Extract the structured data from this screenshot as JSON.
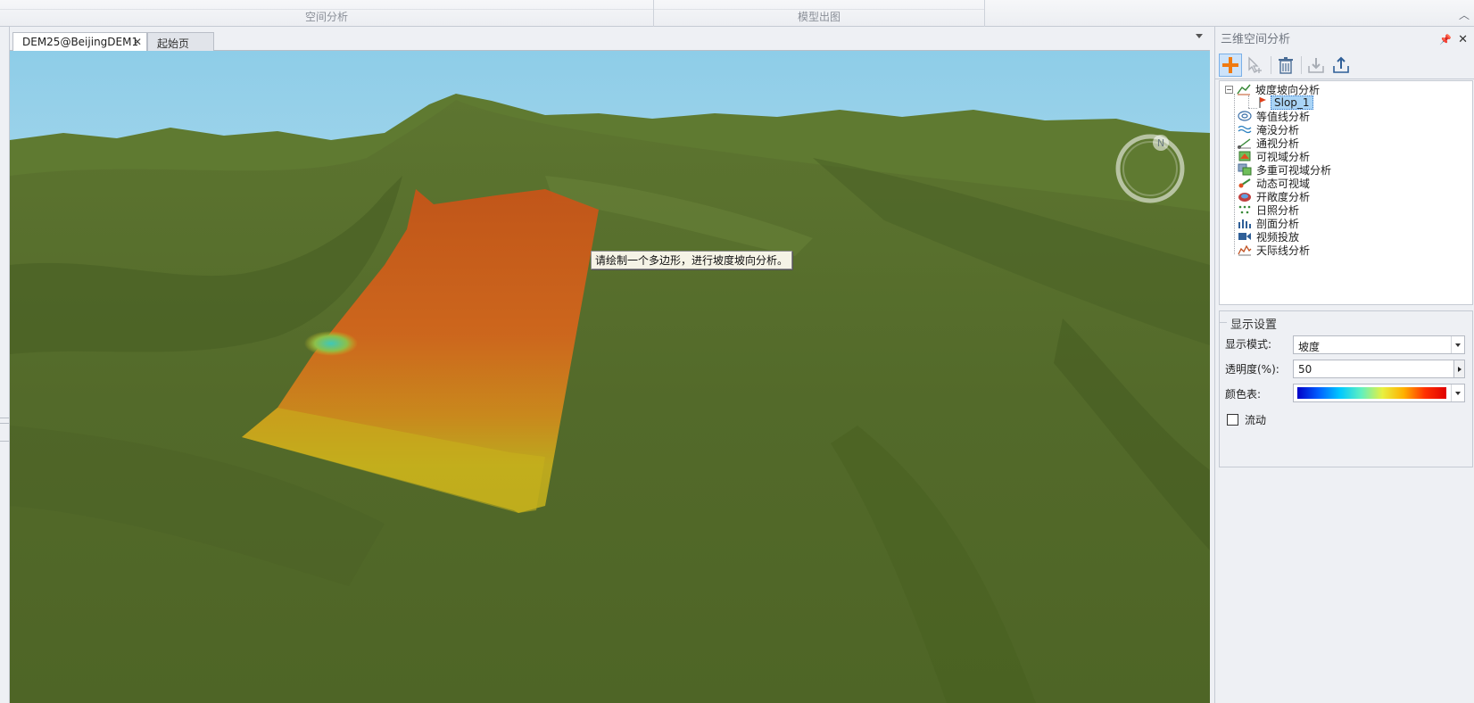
{
  "ribbon": {
    "groups": [
      {
        "label": "空间分析"
      },
      {
        "label": "模型出图"
      }
    ]
  },
  "doc_tabs": [
    {
      "label": "DEM25@BeijingDEM1",
      "active": true
    },
    {
      "label": "起始页",
      "active": false
    }
  ],
  "scene": {
    "tooltip": "请绘制一个多边形，进行坡度坡向分析。",
    "compass_letter": "N"
  },
  "panel": {
    "title": "三维空间分析",
    "toolbar": [
      {
        "icon": "add-icon",
        "enabled": true
      },
      {
        "icon": "select-cursor-icon",
        "enabled": false
      },
      {
        "icon": "delete-icon",
        "enabled": true
      },
      {
        "icon": "import-icon",
        "enabled": false
      },
      {
        "icon": "export-icon",
        "enabled": true
      }
    ],
    "tree": [
      {
        "label": "坡度坡向分析",
        "icon": "slope-icon",
        "expanded": true,
        "children": [
          {
            "label": "Slop_1",
            "icon": "flag-icon",
            "selected": true
          }
        ]
      },
      {
        "label": "等值线分析",
        "icon": "contour-icon"
      },
      {
        "label": "淹没分析",
        "icon": "flood-icon"
      },
      {
        "label": "通视分析",
        "icon": "sightline-icon"
      },
      {
        "label": "可视域分析",
        "icon": "viewshed-icon"
      },
      {
        "label": "多重可视域分析",
        "icon": "multi-viewshed-icon"
      },
      {
        "label": "动态可视域",
        "icon": "dynamic-viewshed-icon"
      },
      {
        "label": "开敞度分析",
        "icon": "openness-icon"
      },
      {
        "label": "日照分析",
        "icon": "sunlight-icon"
      },
      {
        "label": "剖面分析",
        "icon": "profile-icon"
      },
      {
        "label": "视频投放",
        "icon": "video-icon"
      },
      {
        "label": "天际线分析",
        "icon": "skyline-icon"
      }
    ],
    "settings": {
      "title": "显示设置",
      "display_mode_label": "显示模式:",
      "display_mode_value": "坡度",
      "transparency_label": "透明度(%):",
      "transparency_value": "50",
      "color_table_label": "颜色表:",
      "flow_label": "流动",
      "flow_checked": false
    }
  }
}
